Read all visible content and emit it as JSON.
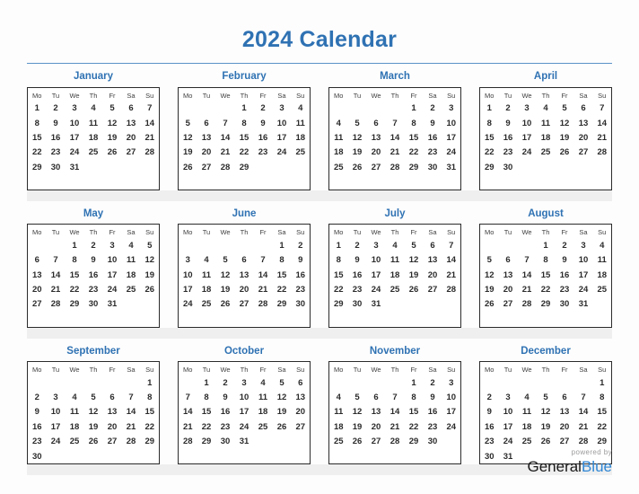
{
  "header": {
    "title": "2024 Calendar",
    "title_color": "#2f72b3",
    "rule_color": "#5b92c7"
  },
  "weekday_headers": [
    "Mo",
    "Tu",
    "We",
    "Th",
    "Fr",
    "Sa",
    "Su"
  ],
  "footer": {
    "powered_by": "powered by",
    "brand_first": "General",
    "brand_second": "Blue",
    "brand_first_color": "#1a1a1a",
    "brand_second_color": "#2f86d4"
  },
  "calendar": {
    "year": "2024",
    "week_start": "Mo",
    "months": [
      {
        "name": "January",
        "lead_blanks": 0,
        "days": 31,
        "weeks": [
          [
            "1",
            "2",
            "3",
            "4",
            "5",
            "6",
            "7"
          ],
          [
            "8",
            "9",
            "10",
            "11",
            "12",
            "13",
            "14"
          ],
          [
            "15",
            "16",
            "17",
            "18",
            "19",
            "20",
            "21"
          ],
          [
            "22",
            "23",
            "24",
            "25",
            "26",
            "27",
            "28"
          ],
          [
            "29",
            "30",
            "31",
            "",
            "",
            "",
            ""
          ],
          [
            "",
            "",
            "",
            "",
            "",
            "",
            ""
          ]
        ]
      },
      {
        "name": "February",
        "lead_blanks": 3,
        "days": 29,
        "weeks": [
          [
            "",
            "",
            "",
            "1",
            "2",
            "3",
            "4"
          ],
          [
            "5",
            "6",
            "7",
            "8",
            "9",
            "10",
            "11"
          ],
          [
            "12",
            "13",
            "14",
            "15",
            "16",
            "17",
            "18"
          ],
          [
            "19",
            "20",
            "21",
            "22",
            "23",
            "24",
            "25"
          ],
          [
            "26",
            "27",
            "28",
            "29",
            "",
            "",
            ""
          ],
          [
            "",
            "",
            "",
            "",
            "",
            "",
            ""
          ]
        ]
      },
      {
        "name": "March",
        "lead_blanks": 4,
        "days": 31,
        "weeks": [
          [
            "",
            "",
            "",
            "",
            "1",
            "2",
            "3"
          ],
          [
            "4",
            "5",
            "6",
            "7",
            "8",
            "9",
            "10"
          ],
          [
            "11",
            "12",
            "13",
            "14",
            "15",
            "16",
            "17"
          ],
          [
            "18",
            "19",
            "20",
            "21",
            "22",
            "23",
            "24"
          ],
          [
            "25",
            "26",
            "27",
            "28",
            "29",
            "30",
            "31"
          ],
          [
            "",
            "",
            "",
            "",
            "",
            "",
            ""
          ]
        ]
      },
      {
        "name": "April",
        "lead_blanks": 0,
        "days": 30,
        "weeks": [
          [
            "1",
            "2",
            "3",
            "4",
            "5",
            "6",
            "7"
          ],
          [
            "8",
            "9",
            "10",
            "11",
            "12",
            "13",
            "14"
          ],
          [
            "15",
            "16",
            "17",
            "18",
            "19",
            "20",
            "21"
          ],
          [
            "22",
            "23",
            "24",
            "25",
            "26",
            "27",
            "28"
          ],
          [
            "29",
            "30",
            "",
            "",
            "",
            "",
            ""
          ],
          [
            "",
            "",
            "",
            "",
            "",
            "",
            ""
          ]
        ]
      },
      {
        "name": "May",
        "lead_blanks": 2,
        "days": 31,
        "weeks": [
          [
            "",
            "",
            "1",
            "2",
            "3",
            "4",
            "5"
          ],
          [
            "6",
            "7",
            "8",
            "9",
            "10",
            "11",
            "12"
          ],
          [
            "13",
            "14",
            "15",
            "16",
            "17",
            "18",
            "19"
          ],
          [
            "20",
            "21",
            "22",
            "23",
            "24",
            "25",
            "26"
          ],
          [
            "27",
            "28",
            "29",
            "30",
            "31",
            "",
            ""
          ],
          [
            "",
            "",
            "",
            "",
            "",
            "",
            ""
          ]
        ]
      },
      {
        "name": "June",
        "lead_blanks": 5,
        "days": 30,
        "weeks": [
          [
            "",
            "",
            "",
            "",
            "",
            "1",
            "2"
          ],
          [
            "3",
            "4",
            "5",
            "6",
            "7",
            "8",
            "9"
          ],
          [
            "10",
            "11",
            "12",
            "13",
            "14",
            "15",
            "16"
          ],
          [
            "17",
            "18",
            "19",
            "20",
            "21",
            "22",
            "23"
          ],
          [
            "24",
            "25",
            "26",
            "27",
            "28",
            "29",
            "30"
          ],
          [
            "",
            "",
            "",
            "",
            "",
            "",
            ""
          ]
        ]
      },
      {
        "name": "July",
        "lead_blanks": 0,
        "days": 31,
        "weeks": [
          [
            "1",
            "2",
            "3",
            "4",
            "5",
            "6",
            "7"
          ],
          [
            "8",
            "9",
            "10",
            "11",
            "12",
            "13",
            "14"
          ],
          [
            "15",
            "16",
            "17",
            "18",
            "19",
            "20",
            "21"
          ],
          [
            "22",
            "23",
            "24",
            "25",
            "26",
            "27",
            "28"
          ],
          [
            "29",
            "30",
            "31",
            "",
            "",
            "",
            ""
          ],
          [
            "",
            "",
            "",
            "",
            "",
            "",
            ""
          ]
        ]
      },
      {
        "name": "August",
        "lead_blanks": 3,
        "days": 31,
        "weeks": [
          [
            "",
            "",
            "",
            "1",
            "2",
            "3",
            "4"
          ],
          [
            "5",
            "6",
            "7",
            "8",
            "9",
            "10",
            "11"
          ],
          [
            "12",
            "13",
            "14",
            "15",
            "16",
            "17",
            "18"
          ],
          [
            "19",
            "20",
            "21",
            "22",
            "23",
            "24",
            "25"
          ],
          [
            "26",
            "27",
            "28",
            "29",
            "30",
            "31",
            ""
          ],
          [
            "",
            "",
            "",
            "",
            "",
            "",
            ""
          ]
        ]
      },
      {
        "name": "September",
        "lead_blanks": 6,
        "days": 30,
        "weeks": [
          [
            "",
            "",
            "",
            "",
            "",
            "",
            "1"
          ],
          [
            "2",
            "3",
            "4",
            "5",
            "6",
            "7",
            "8"
          ],
          [
            "9",
            "10",
            "11",
            "12",
            "13",
            "14",
            "15"
          ],
          [
            "16",
            "17",
            "18",
            "19",
            "20",
            "21",
            "22"
          ],
          [
            "23",
            "24",
            "25",
            "26",
            "27",
            "28",
            "29"
          ],
          [
            "30",
            "",
            "",
            "",
            "",
            "",
            ""
          ]
        ]
      },
      {
        "name": "October",
        "lead_blanks": 1,
        "days": 31,
        "weeks": [
          [
            "",
            "1",
            "2",
            "3",
            "4",
            "5",
            "6"
          ],
          [
            "7",
            "8",
            "9",
            "10",
            "11",
            "12",
            "13"
          ],
          [
            "14",
            "15",
            "16",
            "17",
            "18",
            "19",
            "20"
          ],
          [
            "21",
            "22",
            "23",
            "24",
            "25",
            "26",
            "27"
          ],
          [
            "28",
            "29",
            "30",
            "31",
            "",
            "",
            ""
          ],
          [
            "",
            "",
            "",
            "",
            "",
            "",
            ""
          ]
        ]
      },
      {
        "name": "November",
        "lead_blanks": 4,
        "days": 30,
        "weeks": [
          [
            "",
            "",
            "",
            "",
            "1",
            "2",
            "3"
          ],
          [
            "4",
            "5",
            "6",
            "7",
            "8",
            "9",
            "10"
          ],
          [
            "11",
            "12",
            "13",
            "14",
            "15",
            "16",
            "17"
          ],
          [
            "18",
            "19",
            "20",
            "21",
            "22",
            "23",
            "24"
          ],
          [
            "25",
            "26",
            "27",
            "28",
            "29",
            "30",
            ""
          ],
          [
            "",
            "",
            "",
            "",
            "",
            "",
            ""
          ]
        ]
      },
      {
        "name": "December",
        "lead_blanks": 6,
        "days": 31,
        "weeks": [
          [
            "",
            "",
            "",
            "",
            "",
            "",
            "1"
          ],
          [
            "2",
            "3",
            "4",
            "5",
            "6",
            "7",
            "8"
          ],
          [
            "9",
            "10",
            "11",
            "12",
            "13",
            "14",
            "15"
          ],
          [
            "16",
            "17",
            "18",
            "19",
            "20",
            "21",
            "22"
          ],
          [
            "23",
            "24",
            "25",
            "26",
            "27",
            "28",
            "29"
          ],
          [
            "30",
            "31",
            "",
            "",
            "",
            "",
            ""
          ]
        ]
      }
    ]
  }
}
